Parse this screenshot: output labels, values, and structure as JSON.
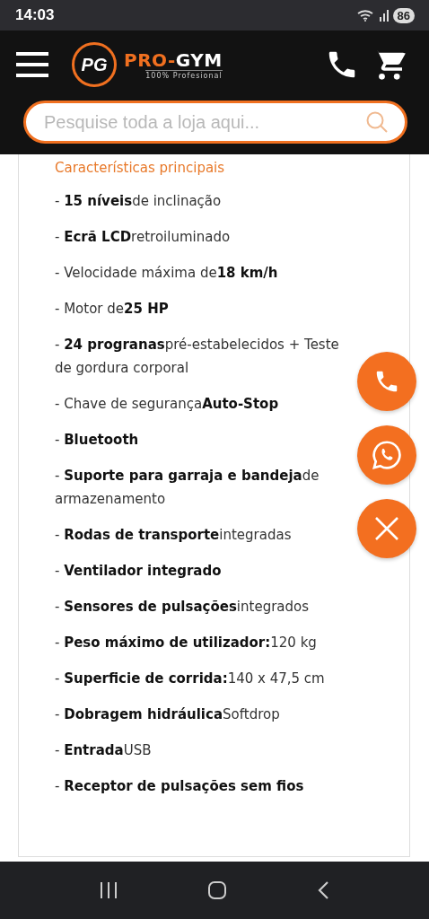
{
  "status_bar": {
    "time": "14:03",
    "battery": "86"
  },
  "header": {
    "logo": {
      "monogram": "PG",
      "brand_first": "PRO-",
      "brand_second": "GYM",
      "tagline": "100% Profesional"
    },
    "search": {
      "placeholder": "Pesquise toda a loja aqui..."
    }
  },
  "section": {
    "title": "Características principais",
    "features": [
      "- **15 níveis**de inclinação",
      "- **Ecrã LCD**retroiluminado",
      "- Velocidade máxima de**18 km/h**",
      "- Motor de**25 HP**",
      "- **24 progranas**pré-estabelecidos + Teste de gordura corporal",
      "- Chave de segurança**Auto-Stop**",
      "- **Bluetooth**",
      "- **Suporte para garraja e bandeja**de armazenamento",
      "- **Rodas de transporte**integradas",
      "- **Ventilador integrado**",
      "- **Sensores de pulsações**integrados",
      "- **Peso máximo de utilizador:**120 kg",
      "- **Superficie de corrida:**140 x 47,5 cm",
      "- **Dobragem hidráulica**Softdrop",
      "- **Entrada**USB",
      "- **Receptor de pulsações sem fios**"
    ]
  },
  "floating_buttons": [
    {
      "kind": "phone"
    },
    {
      "kind": "whatsapp"
    },
    {
      "kind": "close"
    }
  ]
}
